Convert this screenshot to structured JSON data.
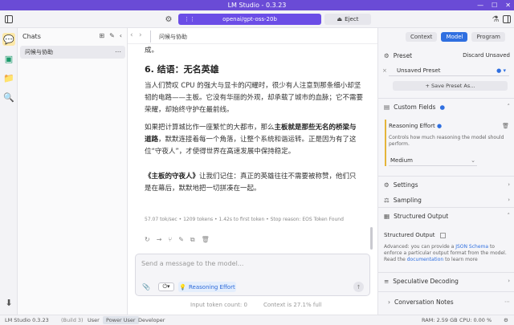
{
  "window": {
    "title": "LM Studio - 0.3.23",
    "controls": [
      "—",
      "☐",
      "✕"
    ]
  },
  "toolbar": {
    "model_name": "openai/gpt-oss-20b",
    "eject_label": "Eject"
  },
  "chats": {
    "title": "Chats",
    "items": [
      {
        "label": "问候与协助"
      }
    ]
  },
  "tab": {
    "label": "问候与协助"
  },
  "message": {
    "top_fragment": "成。",
    "heading": "6. 结语：无名英雄",
    "para1": "当人们赞叹 CPU 的强大与显卡的闪耀时，很少有人注意到那条细小却坚韧的电路——主板。它没有华丽的外观，却承载了城市的血脉；它不需要荣耀，却始终守护在最前线。",
    "para2_a": "如果把计算城比作一座繁忙的大都市，那么",
    "para2_b": "主板就是那些无名的桥梁与道路",
    "para2_c": "，默默连接着每一个角落，让整个系统和谐运转。正是因为有了这位“守夜人”，才使得世界在高速发展中保持稳定。",
    "para3_a": "《主板的守夜人》",
    "para3_b": "让我们记住：真正的英雄往往不需要被称赞，他们只是在幕后，默默地把一切拼凑在一起。",
    "stats": "57.07 tok/sec • 1209 tokens • 1.42s to first token • Stop reason: EOS Token Found"
  },
  "composer": {
    "placeholder": "Send a message to the model...",
    "reasoning_label": "Reasoning Effort",
    "input_tokens": "Input token count: 0",
    "context": "Context is 27.1% full"
  },
  "right_panel": {
    "tabs": [
      "Context",
      "Model",
      "Program"
    ],
    "active_tab": "Model",
    "preset_label": "Preset",
    "discard_label": "Discard Unsaved",
    "preset_value": "Unsaved Preset",
    "save_preset_label": "+ Save Preset As...",
    "custom_fields_label": "Custom Fields",
    "reasoning_title": "Reasoning Effort",
    "reasoning_desc": "Controls how much reasoning the model should perform.",
    "reasoning_value": "Medium",
    "settings_label": "Settings",
    "sampling_label": "Sampling",
    "structured_output_label": "Structured Output",
    "structured_output_toggle": "Structured Output",
    "structured_desc_a": "Advanced: you can provide a ",
    "structured_desc_link": "JSON Schema",
    "structured_desc_b": " to enforce a particular output format from the model. Read the ",
    "structured_desc_link2": "documentation",
    "structured_desc_c": " to learn more",
    "speculative_label": "Speculative Decoding",
    "notes_label": "Conversation Notes"
  },
  "statusbar": {
    "app": "LM Studio 0.3.23",
    "build": "(Build 3)",
    "modes": [
      "User",
      "Power User",
      "Developer"
    ],
    "active_mode": "Power User",
    "ram": "RAM: 2.59 GB",
    "cpu": "CPU: 0.00 %"
  },
  "colors": {
    "accent": "#6b4de6",
    "blue": "#2f6fe0",
    "titlebar": "#6a4bd6"
  }
}
